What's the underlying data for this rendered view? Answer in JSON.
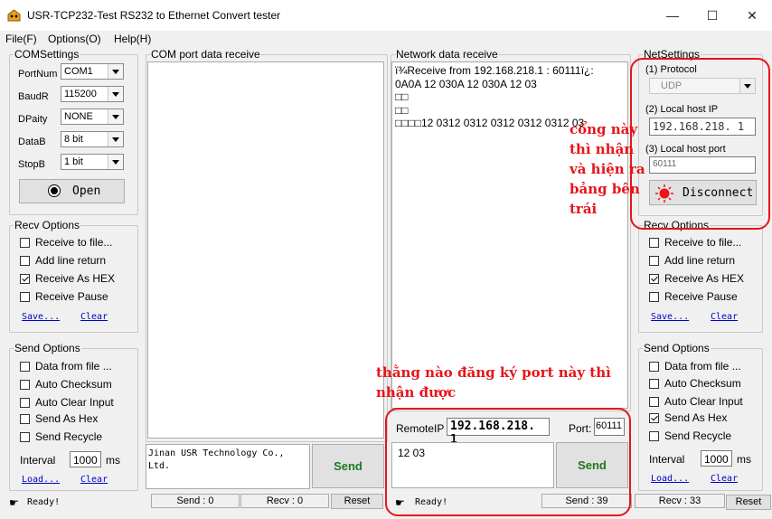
{
  "window": {
    "title": "USR-TCP232-Test  RS232 to Ethernet Convert tester",
    "minimize": "—",
    "maximize": "☐",
    "close": "✕"
  },
  "menu": [
    "File(F)",
    "Options(O)",
    "Help(H)"
  ],
  "com_settings": {
    "legend": "COMSettings",
    "fields": [
      {
        "label": "PortNum",
        "value": "COM1"
      },
      {
        "label": "BaudR",
        "value": "115200"
      },
      {
        "label": "DPaity",
        "value": "NONE"
      },
      {
        "label": "DataB",
        "value": "8 bit"
      },
      {
        "label": "StopB",
        "value": "1 bit"
      }
    ],
    "open_button": "Open"
  },
  "com_recv_options": {
    "legend": "Recv Options",
    "items": [
      {
        "label": "Receive to file...",
        "checked": false
      },
      {
        "label": "Add line return",
        "checked": false
      },
      {
        "label": "Receive As HEX",
        "checked": true
      },
      {
        "label": "Receive Pause",
        "checked": false
      }
    ],
    "save_link": "Save...",
    "clear_link": "Clear"
  },
  "com_send_options": {
    "legend": "Send Options",
    "items": [
      {
        "label": "Data from file ...",
        "checked": false
      },
      {
        "label": "Auto Checksum",
        "checked": false
      },
      {
        "label": "Auto Clear Input",
        "checked": false
      },
      {
        "label": "Send As Hex",
        "checked": false
      },
      {
        "label": "Send Recycle",
        "checked": false
      }
    ],
    "interval_label": "Interval",
    "interval_value": "1000",
    "interval_unit": "ms",
    "load_link": "Load...",
    "clear_link": "Clear"
  },
  "com_port_panel": {
    "legend": "COM port data receive",
    "send_text": "Jinan USR Technology Co., Ltd.",
    "send_button": "Send"
  },
  "network_panel": {
    "legend": "Network data receive",
    "lines": [
      "ï¾Receive from 192.168.218.1 : 60111ï¿:",
      "0A0A 12 030A 12 030A 12 03",
      "□□",
      "□□",
      "□□□□12 0312 0312 0312 0312 0312 03"
    ],
    "remote_ip_label": "RemoteIP",
    "remote_ip_value": "192.168.218. 1",
    "port_label": "Port:",
    "port_value": "60111",
    "send_text": "12 03",
    "send_button": "Send"
  },
  "net_settings": {
    "legend": "NetSettings",
    "protocol_label": "(1) Protocol",
    "protocol_value": "UDP",
    "host_ip_label": "(2) Local host IP",
    "host_ip_value": "192.168.218. 1",
    "host_port_label": "(3) Local host port",
    "host_port_value": "60111",
    "disconnect_button": "Disconnect"
  },
  "net_recv_options": {
    "legend": "Recv Options",
    "items": [
      {
        "label": "Receive to file...",
        "checked": false
      },
      {
        "label": "Add line return",
        "checked": false
      },
      {
        "label": "Receive As HEX",
        "checked": true
      },
      {
        "label": "Receive Pause",
        "checked": false
      }
    ],
    "save_link": "Save...",
    "clear_link": "Clear"
  },
  "net_send_options": {
    "legend": "Send Options",
    "items": [
      {
        "label": "Data from file ...",
        "checked": false
      },
      {
        "label": "Auto Checksum",
        "checked": false
      },
      {
        "label": "Auto Clear Input",
        "checked": false
      },
      {
        "label": "Send As Hex",
        "checked": true
      },
      {
        "label": "Send Recycle",
        "checked": false
      }
    ],
    "interval_label": "Interval",
    "interval_value": "1000",
    "interval_unit": "ms",
    "load_link": "Load...",
    "clear_link": "Clear"
  },
  "status_left": {
    "ready": "Ready!",
    "send": "Send : 0",
    "recv": "Recv : 0",
    "reset": "Reset"
  },
  "status_right": {
    "ready": "Ready!",
    "send": "Send : 39",
    "recv": "Recv : 33",
    "reset": "Reset"
  },
  "annotations": {
    "right_note": [
      "cổng này",
      "thì nhận",
      "và hiện ra",
      "bảng bên",
      "trái"
    ],
    "bottom_note": [
      "thằng nào đăng ký port này thì",
      "nhận được"
    ]
  },
  "colors": {
    "annotation_red": "#e8141a",
    "link_blue": "#0000cc",
    "send_green": "#1e7a1e"
  }
}
